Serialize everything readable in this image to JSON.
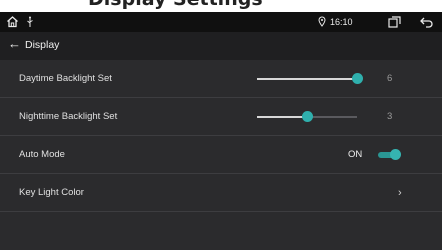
{
  "page_title_partial": "Display Settings",
  "status_bar": {
    "home_icon": "home-icon",
    "usb_icon": "usb-icon",
    "gps_icon": "location-icon",
    "time": "16:10",
    "multiwindow_icon": "multiwindow-icon",
    "back_icon": "back-icon"
  },
  "header": {
    "back_icon": "back-arrow-icon",
    "title": "Display"
  },
  "settings": {
    "daytime": {
      "label": "Daytime Backlight Set",
      "value": "6",
      "level": 6,
      "max": 6
    },
    "nighttime": {
      "label": "Nighttime Backlight Set",
      "value": "3",
      "level": 3,
      "max": 6
    },
    "auto_mode": {
      "label": "Auto Mode",
      "state_text": "ON",
      "enabled": true
    },
    "key_light_color": {
      "label": "Key Light Color",
      "chevron_icon": "chevron-right-icon"
    }
  },
  "colors": {
    "accent": "#2fb0ad",
    "background": "#2b2b2d",
    "status_bar": "#101010"
  }
}
